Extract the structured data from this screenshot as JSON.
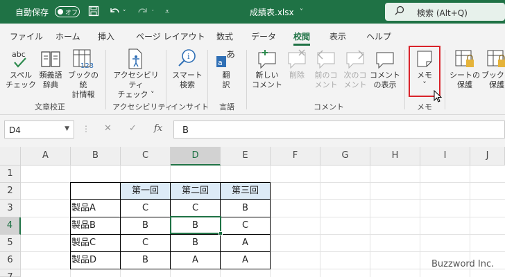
{
  "titlebar": {
    "autosave_label": "自動保存",
    "autosave_state": "オフ",
    "filename": "成績表.xlsx",
    "search_placeholder": "検索 (Alt+Q)"
  },
  "tabs": [
    "ファイル",
    "ホーム",
    "挿入",
    "ページ レイアウト",
    "数式",
    "データ",
    "校閲",
    "表示",
    "ヘルプ"
  ],
  "active_tab": "校閲",
  "ribbon": {
    "spelling": [
      "スペル",
      "チェック"
    ],
    "thesaurus": [
      "類義語",
      "辞典"
    ],
    "workbook_stats": [
      "ブックの統",
      "計情報"
    ],
    "accessibility": [
      "アクセシビリティ",
      "チェック ˅"
    ],
    "smart_lookup": [
      "スマート",
      "検索"
    ],
    "translate": [
      "翻",
      "訳"
    ],
    "new_comment": [
      "新しい",
      "コメント"
    ],
    "delete": [
      "削除"
    ],
    "prev_comment": [
      "前のコ",
      "メント"
    ],
    "next_comment": [
      "次のコ",
      "メント"
    ],
    "show_comments": [
      "コメント",
      "の表示"
    ],
    "memo": [
      "メモ",
      "˅"
    ],
    "protect_sheet": [
      "シートの",
      "保護"
    ],
    "protect_book": [
      "ブックの",
      "保護"
    ],
    "groups": {
      "proofing": "文章校正",
      "accessibility": "アクセシビリティ",
      "insights": "インサイト",
      "language": "言語",
      "comments": "コメント",
      "notes": "メモ"
    }
  },
  "formula_bar": {
    "name_box": "D4",
    "content": "B",
    "fx": "fx"
  },
  "sheet": {
    "columns": [
      "A",
      "B",
      "C",
      "D",
      "E",
      "F",
      "G",
      "H",
      "I",
      "J"
    ],
    "rows": [
      "1",
      "2",
      "3",
      "4",
      "5",
      "6",
      "7"
    ],
    "selected_cell": "D4",
    "table": {
      "headers": [
        "第一回",
        "第二回",
        "第三回"
      ],
      "rows": [
        {
          "label": "製品A",
          "values": [
            "C",
            "C",
            "B"
          ]
        },
        {
          "label": "製品B",
          "values": [
            "B",
            "B",
            "C"
          ]
        },
        {
          "label": "製品C",
          "values": [
            "C",
            "B",
            "A"
          ]
        },
        {
          "label": "製品D",
          "values": [
            "B",
            "A",
            "A"
          ]
        }
      ]
    }
  },
  "watermark": "Buzzword Inc.",
  "colors": {
    "excel_green": "#1f7245",
    "header_fill": "#ddebf7",
    "highlight_red": "#d9232a"
  }
}
